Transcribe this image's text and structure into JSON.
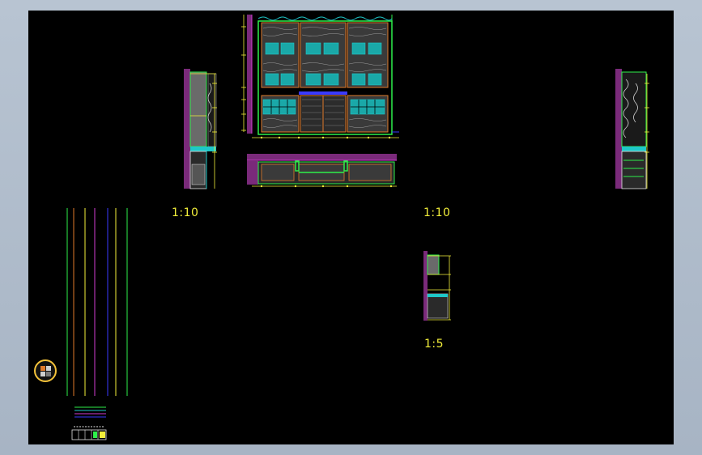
{
  "scales": {
    "label_1": "1:10",
    "label_2": "1:10",
    "label_3": "1:5"
  },
  "colors": {
    "background": "#000000",
    "frame": "#b8c4d2",
    "line_green": "#2ef04a",
    "line_yellow": "#f3ef3a",
    "line_cyan": "#1ec8c8",
    "line_magenta": "#d23cd2",
    "line_orange": "#e07a2a",
    "line_blue": "#3a3aff",
    "line_white": "#e8e8e8"
  },
  "icons": {
    "view_cube": "view-cube-icon"
  }
}
